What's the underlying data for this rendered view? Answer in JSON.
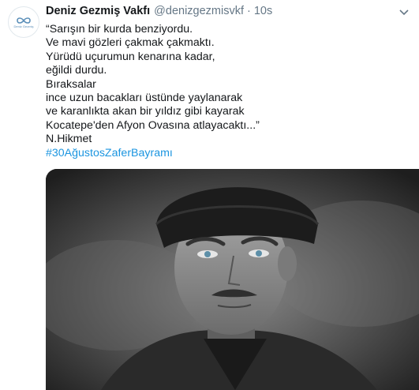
{
  "tweet": {
    "author_name": "Deniz Gezmiş Vakfı",
    "handle": "@denizgezmisvkf",
    "separator": "·",
    "time": "10s",
    "lines": [
      "“Sarışın bir kurda benziyordu.",
      "Ve mavi gözleri çakmak çakmaktı.",
      "Yürüdü uçurumun kenarına kadar,",
      "eğildi durdu.",
      "Bıraksalar",
      "ince uzun bacakları üstünde yaylanarak",
      "ve karanlıkta akan bir yıldız gibi kayarak",
      "Kocatepe'den Afyon Ovasına atlayacaktı...”",
      "N.Hikmet"
    ],
    "hashtag": "#30AğustosZaferBayramı"
  },
  "avatar": {
    "logo_text": "Deniz Gezmiş",
    "icon": "infinity-logo-icon",
    "color": "#5b8fb9"
  },
  "media": {
    "icon": "portrait-photo"
  },
  "colors": {
    "text": "#14171a",
    "secondary": "#657786",
    "link": "#1b95e0"
  }
}
